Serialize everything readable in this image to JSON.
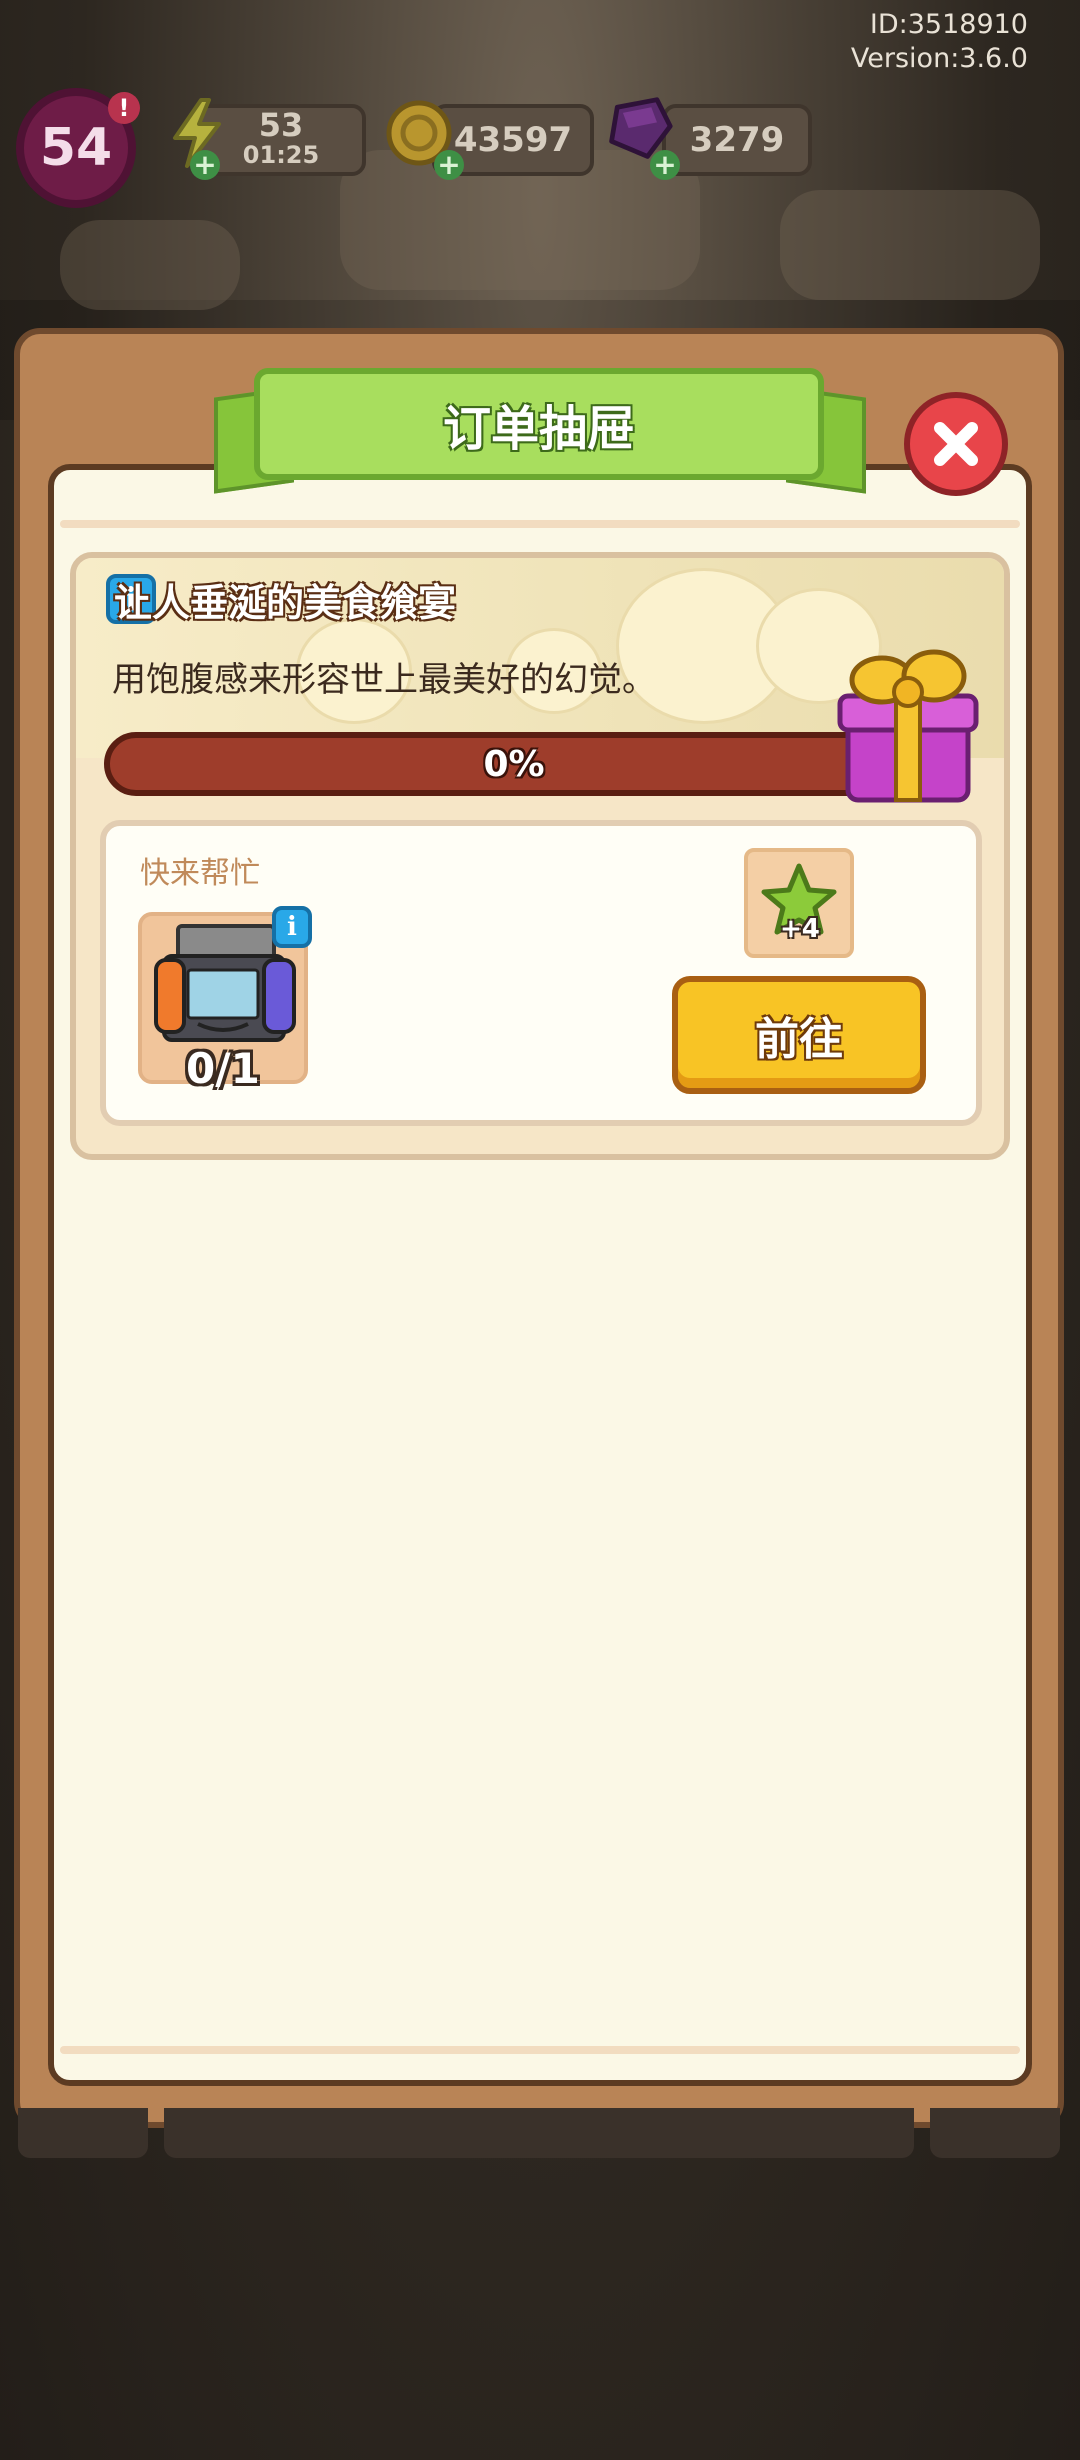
{
  "hud": {
    "id_text": "ID:3518910",
    "version_text": "Version:3.6.0",
    "level": "54",
    "level_alert": "!",
    "energy": "53",
    "energy_timer": "01:25",
    "coins": "43597",
    "gems": "3279",
    "plus": "+"
  },
  "dialog": {
    "title": "订单抽屉",
    "close_icon": "close-x-icon"
  },
  "order": {
    "info_glyph": "i",
    "title": "让人垂涎的美食飨宴",
    "description": "用饱腹感来形容世上最美好的幻觉。",
    "progress_value": 0,
    "progress_text": "0%",
    "task_label": "快来帮忙",
    "item_count": "0/1",
    "reward_count": "+4",
    "go_button": "前往"
  },
  "colors": {
    "title_green": "#a8de5e",
    "close_red": "#e8454a",
    "progress_track": "#9e3d2b",
    "button_yellow": "#f8c425",
    "panel_cream": "#fbf8e6"
  }
}
